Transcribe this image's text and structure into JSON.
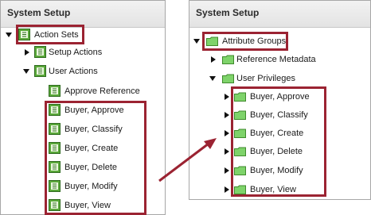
{
  "left_panel": {
    "title": "System Setup",
    "root": "Action Sets",
    "groups": [
      {
        "label": "Setup Actions",
        "state": "collapsed"
      },
      {
        "label": "User Actions",
        "state": "expanded"
      }
    ],
    "children": [
      "Approve Reference",
      "Buyer, Approve",
      "Buyer, Classify",
      "Buyer, Create",
      "Buyer, Delete",
      "Buyer, Modify",
      "Buyer, View"
    ]
  },
  "right_panel": {
    "title": "System Setup",
    "root": "Attribute Groups",
    "groups": [
      {
        "label": "Reference Metadata",
        "state": "collapsed"
      },
      {
        "label": "User Privileges",
        "state": "expanded"
      }
    ],
    "children": [
      "Buyer, Approve",
      "Buyer, Classify",
      "Buyer, Create",
      "Buyer, Delete",
      "Buyer, Modify",
      "Buyer, View"
    ]
  },
  "colors": {
    "highlight_border": "#9b2332",
    "action_icon": "#5aa83a",
    "folder_icon": "#7ed36a"
  },
  "icons": {
    "left_tree": "action-set-icon",
    "right_tree": "folder-icon"
  }
}
